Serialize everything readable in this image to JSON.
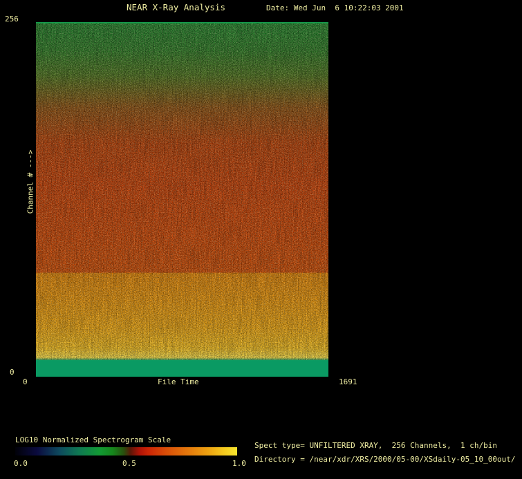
{
  "header": {
    "title": "NEAR X-Ray Analysis",
    "date": "Date: Wed Jun  6 10:22:03 2001"
  },
  "axes": {
    "y_max": "256",
    "y_min": "0",
    "y_label": "Channel # --->",
    "x_min": "0",
    "x_label": "File Time",
    "x_max": "1691"
  },
  "colorbar": {
    "title": "LOG10 Normalized Spectrogram Scale",
    "ticks": [
      "0.0",
      "0.5",
      "1.0"
    ],
    "gradient_stops": [
      "#010108",
      "#0b0b3f",
      "#0e4a5e",
      "#0f7a52",
      "#129a34",
      "#16861c",
      "#294e0e",
      "#5c1607",
      "#b01307",
      "#cc2506",
      "#d94e08",
      "#e4790c",
      "#eda211",
      "#f4c91e",
      "#f6e42e"
    ]
  },
  "info": {
    "spect_type": "Spect type= UNFILTERED XRAY,  256 Channels,  1 ch/bin",
    "directory": "Directory = /near/xdr/XRS/2000/05-00/XSdaily-05_10_00out/"
  },
  "colors": {
    "background": "#000000",
    "text": "#efeda2",
    "bottom_band_green": "#0a9a63",
    "top_band_green": "#20802c",
    "mid_red": "#c84406",
    "lower_orange": "#eca412",
    "bright_yellow": "#f8dd4a"
  },
  "chart_data": {
    "type": "heatmap",
    "title": "NEAR X-Ray Analysis",
    "subtitle": "Date: Wed Jun  6 10:22:03 2001",
    "xlabel": "File Time",
    "ylabel": "Channel # --->",
    "xlim": [
      0,
      1691
    ],
    "ylim": [
      0,
      256
    ],
    "colorbar": {
      "label": "LOG10 Normalized Spectrogram Scale",
      "ticks": [
        0.0,
        0.5,
        1.0
      ],
      "scale": "log10 normalized, 0.0=dark blue, 0.4=green, 0.55=red, 0.8=orange, 1.0=yellow"
    },
    "grid": false,
    "legend": false,
    "bands": [
      {
        "channel_range": [
          228,
          256
        ],
        "approx_value": 0.42,
        "appearance": "noisy green with sparse dark pixels"
      },
      {
        "channel_range": [
          150,
          228
        ],
        "approx_value": 0.5,
        "appearance": "noisy green-to-red transition"
      },
      {
        "channel_range": [
          75,
          150
        ],
        "approx_value": 0.58,
        "appearance": "noisy red / orange-red"
      },
      {
        "channel_range": [
          40,
          75
        ],
        "approx_value": 0.78,
        "appearance": "noisy orange (sharp boundary at channel ~75)"
      },
      {
        "channel_range": [
          12,
          40
        ],
        "approx_value": 0.88,
        "appearance": "bright orange-yellow, brightening toward lower channels"
      },
      {
        "channel_range": [
          0,
          12
        ],
        "approx_value": 0.42,
        "appearance": "uniform solid green band"
      }
    ],
    "notes": "Spectrogram spans full file time range 0-1691 with per-column noise; values constant in time on average"
  }
}
